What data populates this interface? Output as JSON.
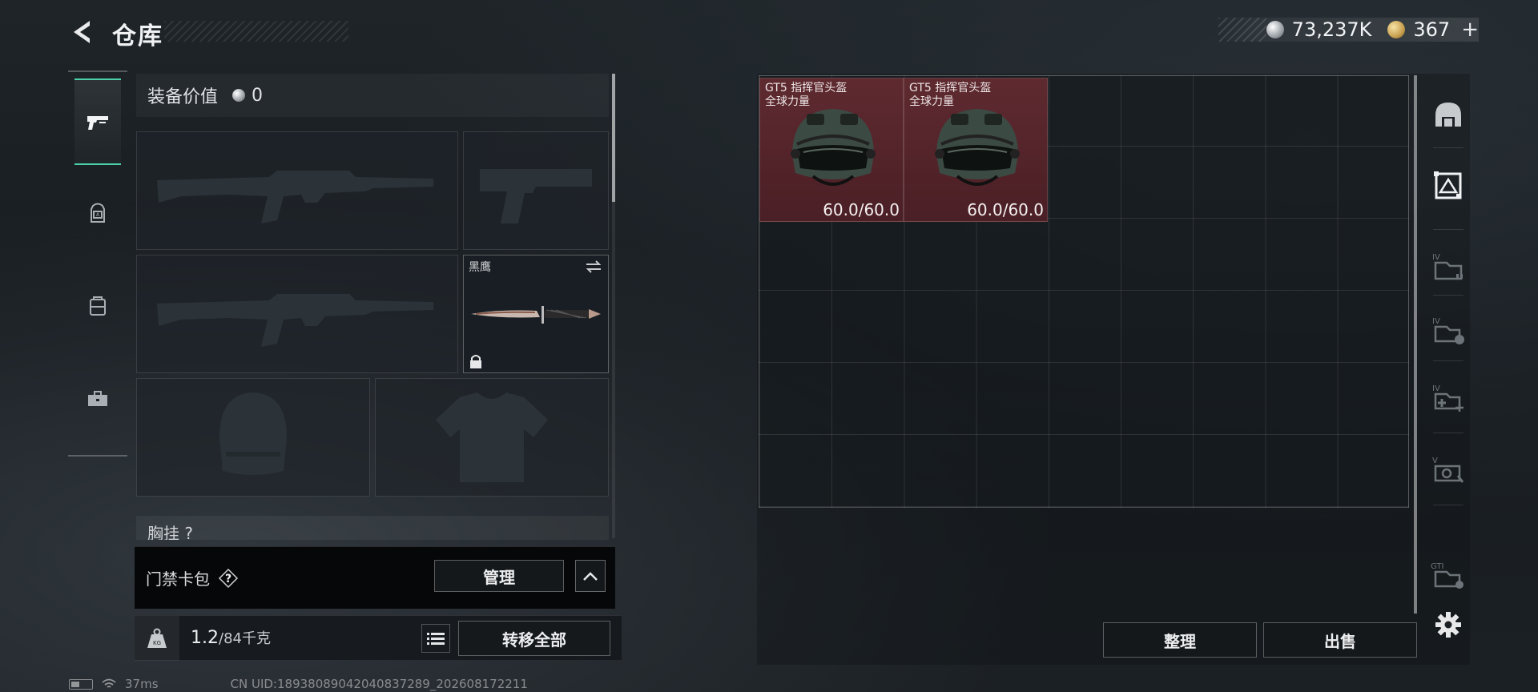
{
  "header": {
    "title": "仓库",
    "currencies": [
      {
        "icon": "silver-coin-icon",
        "value": "73,237K"
      },
      {
        "icon": "gold-coin-icon",
        "value": "367",
        "suffix": "+"
      }
    ]
  },
  "left_tabs": [
    {
      "icon": "pistol-icon",
      "active": true
    },
    {
      "icon": "backpack-icon",
      "active": false
    },
    {
      "icon": "container-icon",
      "active": false
    },
    {
      "icon": "toolbox-icon",
      "active": false
    }
  ],
  "equipment": {
    "value_label": "装备价值",
    "value": "0",
    "slots": {
      "knife_label": "黑鹰"
    },
    "partial_section_label": "胸挂 ?",
    "card_bar": {
      "label": "门禁卡包",
      "help": "?",
      "manage_label": "管理"
    },
    "weight": {
      "current": "1.2",
      "max": "/84千克"
    },
    "transfer_all_label": "转移全部"
  },
  "storage": {
    "items": [
      {
        "name_line1": "GT5 指挥官头盔",
        "name_line2": "全球力量",
        "durability": "60.0/60.0"
      },
      {
        "name_line1": "GT5 指挥官头盔",
        "name_line2": "全球力量",
        "durability": "60.0/60.0"
      }
    ],
    "side_icons": [
      "helmet-icon",
      "armor-box-icon",
      "inventory-iv-icon",
      "inventory-iv-lock-icon",
      "inventory-iv-add-icon",
      "inventory-v-icon",
      "inventory-gti-icon",
      "settings-icon"
    ],
    "sort_label": "整理",
    "sell_label": "出售"
  },
  "status": {
    "ping": "37ms",
    "uid": "CN UID:18938089042040837289_202608172211"
  },
  "colors": {
    "accent": "#4bd0a8",
    "item_bg": "#5e2a30"
  }
}
